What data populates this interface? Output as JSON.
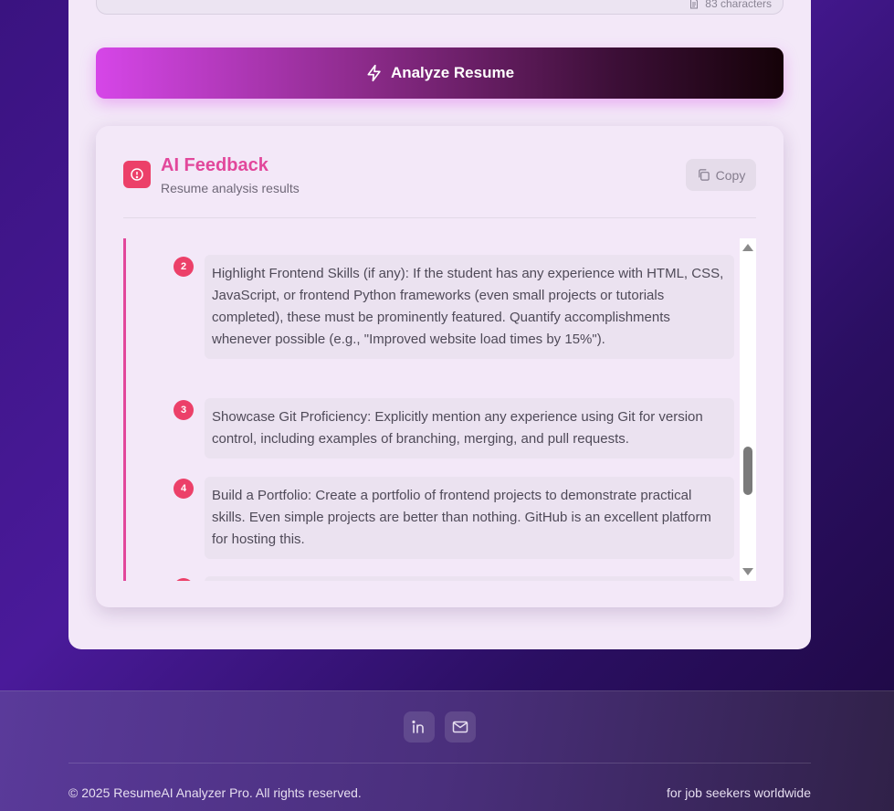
{
  "input": {
    "char_count_label": "83 characters"
  },
  "analyze_button": {
    "label": "Analyze Resume"
  },
  "feedback": {
    "title": "AI Feedback",
    "subtitle": "Resume analysis results",
    "copy_label": "Copy",
    "items": [
      {
        "number": "2",
        "text": "Highlight Frontend Skills (if any): If the student has any experience with HTML, CSS, JavaScript, or frontend Python frameworks (even small projects or tutorials completed), these must be prominently featured. Quantify accomplishments whenever possible (e.g., \"Improved website load times by 15%\")."
      },
      {
        "number": "3",
        "text": "Showcase Git Proficiency: Explicitly mention any experience using Git for version control, including examples of branching, merging, and pull requests."
      },
      {
        "number": "4",
        "text": "Build a Portfolio: Create a portfolio of frontend projects to demonstrate practical skills. Even simple projects are better than nothing. GitHub is an excellent platform for hosting this."
      }
    ]
  },
  "footer": {
    "social": [
      "linkedin-icon",
      "mail-icon"
    ],
    "copyright": "© 2025 ResumeAI Analyzer Pro. All rights reserved.",
    "tagline": "for job seekers worldwide"
  },
  "colors": {
    "accent_pink": "#e2479b",
    "badge_red": "#ec4069",
    "button_gradient_start": "#d646e8",
    "button_gradient_end": "#150208"
  }
}
